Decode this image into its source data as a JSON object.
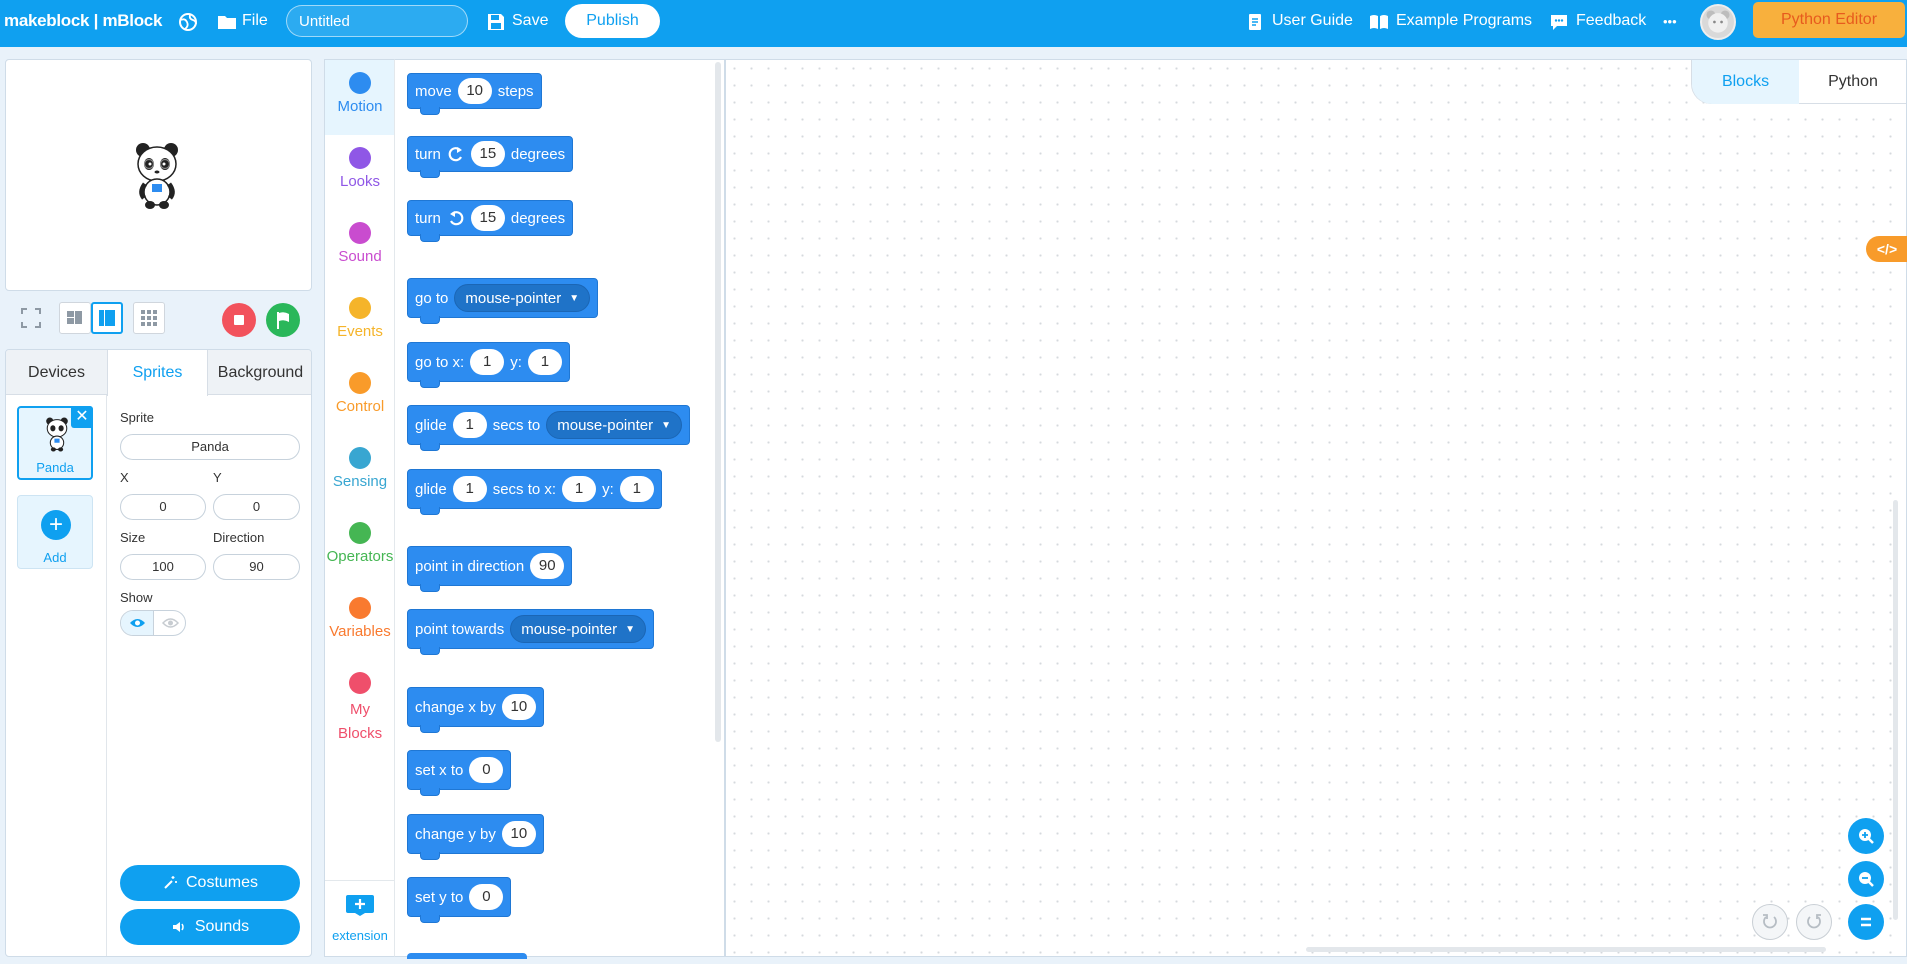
{
  "header": {
    "brand": "makeblock | mBlock",
    "file_label": "File",
    "project_title_placeholder": "Untitled",
    "save_label": "Save",
    "publish_label": "Publish",
    "user_guide_label": "User Guide",
    "example_programs_label": "Example Programs",
    "feedback_label": "Feedback",
    "more_label": "•••",
    "python_editor_label": "Python Editor"
  },
  "sprite_panel": {
    "tabs": [
      "Devices",
      "Sprites",
      "Background"
    ],
    "active_tab": "Sprites",
    "sprites": [
      {
        "name": "Panda"
      }
    ],
    "add_label": "Add",
    "props": {
      "sprite_label": "Sprite",
      "sprite_value": "Panda",
      "x_label": "X",
      "x_value": "0",
      "y_label": "Y",
      "y_value": "0",
      "size_label": "Size",
      "size_value": "100",
      "direction_label": "Direction",
      "direction_value": "90",
      "show_label": "Show"
    },
    "costumes_label": "Costumes",
    "sounds_label": "Sounds"
  },
  "categories": [
    {
      "name": "Motion",
      "color": "#2d8cf0"
    },
    {
      "name": "Looks",
      "color": "#8f57e6"
    },
    {
      "name": "Sound",
      "color": "#c94ccf"
    },
    {
      "name": "Events",
      "color": "#f5b42a"
    },
    {
      "name": "Control",
      "color": "#f99b2a"
    },
    {
      "name": "Sensing",
      "color": "#38a6d1"
    },
    {
      "name": "Operators",
      "color": "#45b653"
    },
    {
      "name": "Variables",
      "color": "#f97a2f"
    },
    {
      "name": "My Blocks",
      "color": "#ef4f6b"
    }
  ],
  "extension_label": "extension",
  "blocks": {
    "move": {
      "label": "move",
      "steps": "10",
      "suffix": "steps"
    },
    "turn_cw": {
      "label": "turn",
      "value": "15",
      "suffix": "degrees"
    },
    "turn_ccw": {
      "label": "turn",
      "value": "15",
      "suffix": "degrees"
    },
    "go_to": {
      "label": "go to",
      "target": "mouse-pointer"
    },
    "go_to_xy": {
      "label": "go to x:",
      "x": "1",
      "y_label": "y:",
      "y": "1"
    },
    "glide_to": {
      "label": "glide",
      "secs": "1",
      "mid": "secs to",
      "target": "mouse-pointer"
    },
    "glide_xy": {
      "label": "glide",
      "secs": "1",
      "mid": "secs to x:",
      "x": "1",
      "y_label": "y:",
      "y": "1"
    },
    "point_dir": {
      "label": "point in direction",
      "value": "90"
    },
    "point_towards": {
      "label": "point towards",
      "target": "mouse-pointer"
    },
    "change_x": {
      "label": "change x by",
      "value": "10"
    },
    "set_x": {
      "label": "set x to",
      "value": "0"
    },
    "change_y": {
      "label": "change y by",
      "value": "10"
    },
    "set_y": {
      "label": "set y to",
      "value": "0"
    }
  },
  "workspace": {
    "tabs": [
      "Blocks",
      "Python"
    ],
    "active_tab": "Blocks",
    "code_badge": "</>"
  }
}
